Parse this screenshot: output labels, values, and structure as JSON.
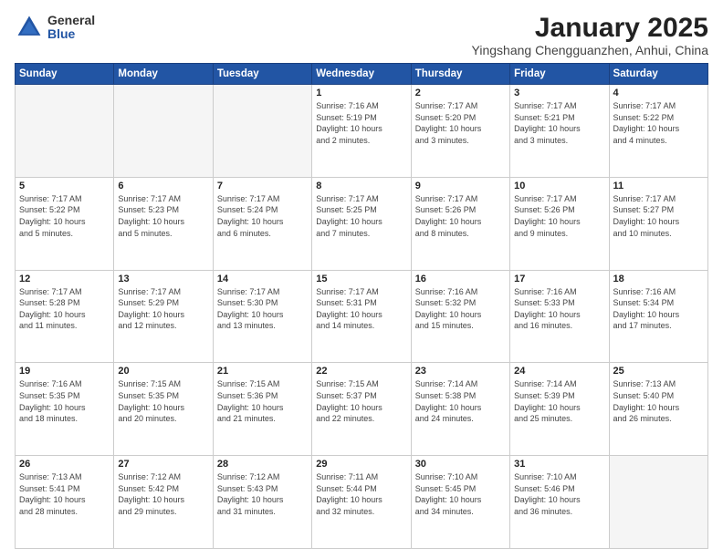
{
  "header": {
    "logo_general": "General",
    "logo_blue": "Blue",
    "title": "January 2025",
    "subtitle": "Yingshang Chengguanzhen, Anhui, China"
  },
  "weekdays": [
    "Sunday",
    "Monday",
    "Tuesday",
    "Wednesday",
    "Thursday",
    "Friday",
    "Saturday"
  ],
  "weeks": [
    [
      {
        "day": "",
        "info": ""
      },
      {
        "day": "",
        "info": ""
      },
      {
        "day": "",
        "info": ""
      },
      {
        "day": "1",
        "info": "Sunrise: 7:16 AM\nSunset: 5:19 PM\nDaylight: 10 hours\nand 2 minutes."
      },
      {
        "day": "2",
        "info": "Sunrise: 7:17 AM\nSunset: 5:20 PM\nDaylight: 10 hours\nand 3 minutes."
      },
      {
        "day": "3",
        "info": "Sunrise: 7:17 AM\nSunset: 5:21 PM\nDaylight: 10 hours\nand 3 minutes."
      },
      {
        "day": "4",
        "info": "Sunrise: 7:17 AM\nSunset: 5:22 PM\nDaylight: 10 hours\nand 4 minutes."
      }
    ],
    [
      {
        "day": "5",
        "info": "Sunrise: 7:17 AM\nSunset: 5:22 PM\nDaylight: 10 hours\nand 5 minutes."
      },
      {
        "day": "6",
        "info": "Sunrise: 7:17 AM\nSunset: 5:23 PM\nDaylight: 10 hours\nand 5 minutes."
      },
      {
        "day": "7",
        "info": "Sunrise: 7:17 AM\nSunset: 5:24 PM\nDaylight: 10 hours\nand 6 minutes."
      },
      {
        "day": "8",
        "info": "Sunrise: 7:17 AM\nSunset: 5:25 PM\nDaylight: 10 hours\nand 7 minutes."
      },
      {
        "day": "9",
        "info": "Sunrise: 7:17 AM\nSunset: 5:26 PM\nDaylight: 10 hours\nand 8 minutes."
      },
      {
        "day": "10",
        "info": "Sunrise: 7:17 AM\nSunset: 5:26 PM\nDaylight: 10 hours\nand 9 minutes."
      },
      {
        "day": "11",
        "info": "Sunrise: 7:17 AM\nSunset: 5:27 PM\nDaylight: 10 hours\nand 10 minutes."
      }
    ],
    [
      {
        "day": "12",
        "info": "Sunrise: 7:17 AM\nSunset: 5:28 PM\nDaylight: 10 hours\nand 11 minutes."
      },
      {
        "day": "13",
        "info": "Sunrise: 7:17 AM\nSunset: 5:29 PM\nDaylight: 10 hours\nand 12 minutes."
      },
      {
        "day": "14",
        "info": "Sunrise: 7:17 AM\nSunset: 5:30 PM\nDaylight: 10 hours\nand 13 minutes."
      },
      {
        "day": "15",
        "info": "Sunrise: 7:17 AM\nSunset: 5:31 PM\nDaylight: 10 hours\nand 14 minutes."
      },
      {
        "day": "16",
        "info": "Sunrise: 7:16 AM\nSunset: 5:32 PM\nDaylight: 10 hours\nand 15 minutes."
      },
      {
        "day": "17",
        "info": "Sunrise: 7:16 AM\nSunset: 5:33 PM\nDaylight: 10 hours\nand 16 minutes."
      },
      {
        "day": "18",
        "info": "Sunrise: 7:16 AM\nSunset: 5:34 PM\nDaylight: 10 hours\nand 17 minutes."
      }
    ],
    [
      {
        "day": "19",
        "info": "Sunrise: 7:16 AM\nSunset: 5:35 PM\nDaylight: 10 hours\nand 18 minutes."
      },
      {
        "day": "20",
        "info": "Sunrise: 7:15 AM\nSunset: 5:35 PM\nDaylight: 10 hours\nand 20 minutes."
      },
      {
        "day": "21",
        "info": "Sunrise: 7:15 AM\nSunset: 5:36 PM\nDaylight: 10 hours\nand 21 minutes."
      },
      {
        "day": "22",
        "info": "Sunrise: 7:15 AM\nSunset: 5:37 PM\nDaylight: 10 hours\nand 22 minutes."
      },
      {
        "day": "23",
        "info": "Sunrise: 7:14 AM\nSunset: 5:38 PM\nDaylight: 10 hours\nand 24 minutes."
      },
      {
        "day": "24",
        "info": "Sunrise: 7:14 AM\nSunset: 5:39 PM\nDaylight: 10 hours\nand 25 minutes."
      },
      {
        "day": "25",
        "info": "Sunrise: 7:13 AM\nSunset: 5:40 PM\nDaylight: 10 hours\nand 26 minutes."
      }
    ],
    [
      {
        "day": "26",
        "info": "Sunrise: 7:13 AM\nSunset: 5:41 PM\nDaylight: 10 hours\nand 28 minutes."
      },
      {
        "day": "27",
        "info": "Sunrise: 7:12 AM\nSunset: 5:42 PM\nDaylight: 10 hours\nand 29 minutes."
      },
      {
        "day": "28",
        "info": "Sunrise: 7:12 AM\nSunset: 5:43 PM\nDaylight: 10 hours\nand 31 minutes."
      },
      {
        "day": "29",
        "info": "Sunrise: 7:11 AM\nSunset: 5:44 PM\nDaylight: 10 hours\nand 32 minutes."
      },
      {
        "day": "30",
        "info": "Sunrise: 7:10 AM\nSunset: 5:45 PM\nDaylight: 10 hours\nand 34 minutes."
      },
      {
        "day": "31",
        "info": "Sunrise: 7:10 AM\nSunset: 5:46 PM\nDaylight: 10 hours\nand 36 minutes."
      },
      {
        "day": "",
        "info": ""
      }
    ]
  ]
}
